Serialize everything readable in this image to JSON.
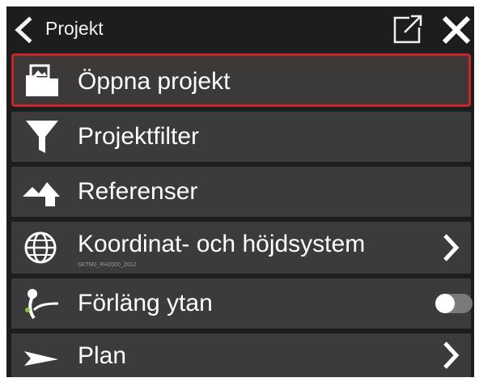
{
  "header": {
    "title": "Projekt",
    "back_icon": "chevron-left-icon",
    "popout_icon": "open-external-icon",
    "close_icon": "close-icon"
  },
  "menu": {
    "items": [
      {
        "label": "Öppna projekt",
        "icon": "folder-image-icon",
        "selected": true
      },
      {
        "label": "Projektfilter",
        "icon": "filter-icon"
      },
      {
        "label": "Referenser",
        "icon": "terrain-icon"
      },
      {
        "label": "Koordinat- och höjdsystem",
        "subtitle": "SKTM0_RH2000_2012",
        "icon": "globe-icon",
        "trailing": "chevron-right-icon"
      },
      {
        "label": "Förläng ytan",
        "icon": "extend-surface-icon",
        "trailing": "toggle",
        "toggle_on": false
      },
      {
        "label": "Plan",
        "icon": "plan-icon",
        "trailing": "chevron-right-icon"
      }
    ]
  },
  "colors": {
    "background": "#1d1d1d",
    "item_background": "#3b3b3b",
    "selected_border": "#c8262a",
    "text": "#ffffff"
  }
}
